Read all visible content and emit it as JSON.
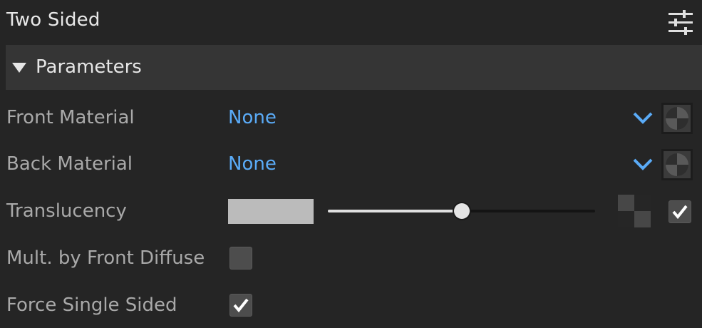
{
  "panel": {
    "title": "Two Sided",
    "settings_icon": "sliders-icon"
  },
  "section": {
    "label": "Parameters",
    "expanded": true,
    "icon": "triangle-down-icon"
  },
  "rows": {
    "front_material": {
      "label": "Front Material",
      "value": "None"
    },
    "back_material": {
      "label": "Back Material",
      "value": "None"
    },
    "translucency": {
      "label": "Translucency",
      "color": "#bbbbbb",
      "amount": 0.5,
      "enabled": true
    },
    "mult_front_diffuse": {
      "label": "Mult. by Front Diffuse",
      "checked": false
    },
    "force_single_sided": {
      "label": "Force Single Sided",
      "checked": true
    }
  },
  "colors": {
    "link": "#5aabf7",
    "background": "#252525",
    "header": "#353535"
  }
}
